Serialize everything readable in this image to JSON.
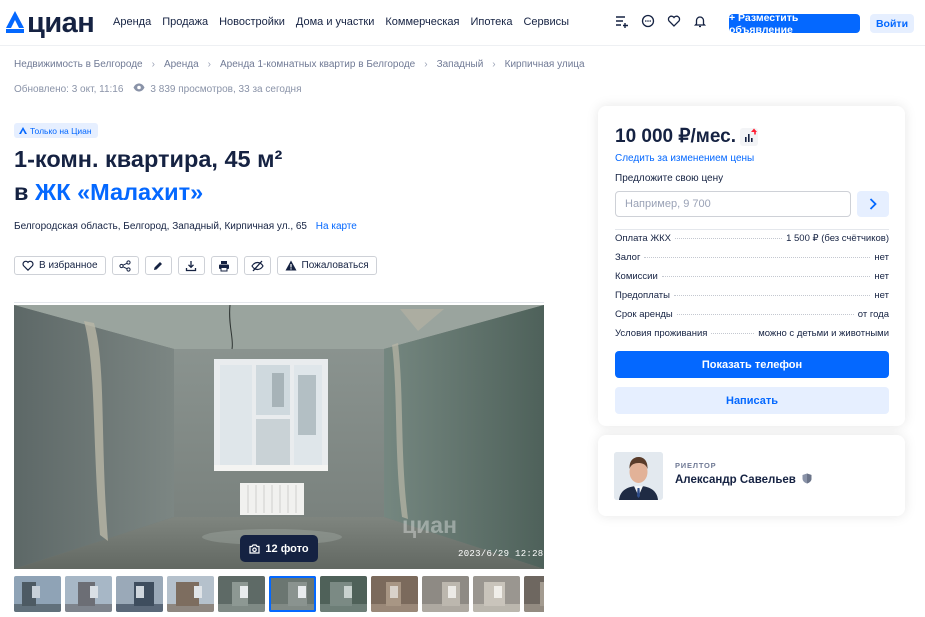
{
  "header": {
    "logo": "циан",
    "nav": [
      "Аренда",
      "Продажа",
      "Новостройки",
      "Дома и участки",
      "Коммерческая",
      "Ипотека",
      "Сервисы"
    ],
    "post_button": "+ Разместить объявление",
    "login_button": "Войти"
  },
  "breadcrumb": [
    "Недвижимость в Белгороде",
    "Аренда",
    "Аренда 1-комнатных квартир в Белгороде",
    "Западный",
    "Кирпичная улица"
  ],
  "meta": {
    "updated": "Обновлено: 3 окт, 11:16",
    "views": "3 839 просмотров, 33 за сегодня"
  },
  "listing": {
    "badge": "Только на Циан",
    "title_line1": "1-комн. квартира, 45 м²",
    "title_prefix": "в",
    "complex": "ЖК «Малахит»",
    "address": "Белгородская область, Белгород, Западный, Кирпичная ул., 65",
    "map_link": "На карте",
    "favorite": "В избранное",
    "report": "Пожаловаться"
  },
  "gallery": {
    "photo_count": "12 фото",
    "stamp": "2023/6/29  12:28",
    "watermark": "циан",
    "thumb_count": 11,
    "active_thumb": 5
  },
  "price_card": {
    "price": "10 000 ₽/мес.",
    "follow": "Следить за изменением цены",
    "offer_label": "Предложите свою цену",
    "offer_placeholder": "Например, 9 700",
    "conditions": [
      {
        "label": "Оплата ЖКХ",
        "value": "1 500 ₽ (без счётчиков)"
      },
      {
        "label": "Залог",
        "value": "нет"
      },
      {
        "label": "Комиссии",
        "value": "нет"
      },
      {
        "label": "Предоплаты",
        "value": "нет"
      },
      {
        "label": "Срок аренды",
        "value": "от года"
      },
      {
        "label": "Условия проживания",
        "value": "можно с детьми и животными"
      }
    ],
    "show_phone": "Показать телефон",
    "write": "Написать"
  },
  "agent": {
    "role": "РИЕЛТОР",
    "name": "Александр Савельев"
  },
  "colors": {
    "accent": "#0468ff",
    "text": "#152242",
    "accent_light": "#e6efff"
  }
}
